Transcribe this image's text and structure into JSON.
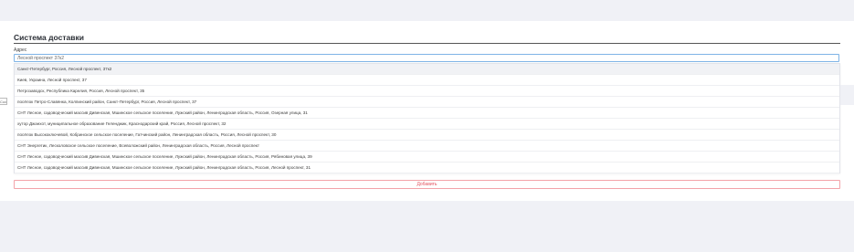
{
  "page": {
    "title": "Система доставки",
    "address_label": "Адрес",
    "left_peek_text": "Сох"
  },
  "search": {
    "value": "Лесной проспект 37к2"
  },
  "suggestions": [
    "Санкт-Петербург, Россия, Лесной проспект, 37к2",
    "Киев, Украина, Лесной проспект, 37",
    "Петрозаводск, Республика Карелия, Россия, Лесной проспект, 35",
    "посёлок Петро-Славянка, Колпинский район, Санкт-Петербург, Россия, Лесной проспект, 37",
    "СНТ Лесное, садоводческий массив Дивенская, Мшинское сельское поселение, Лужский район, Ленинградская область, Россия, Озерная улица, 31",
    "хутор Джанхот, муниципальное образование Геленджик, Краснодарский край, Россия, Лесной проспект, 32",
    "посёлок Высокоключевой, Кобринское сельское поселение, Гатчинский район, Ленинградская область, Россия, Лесной проспект, 30",
    "СНТ Энергетик, Лесколовское сельское поселение, Всеволожский район, Ленинградская область, Россия, Лесной проспект",
    "СНТ Лесное, садоводческий массив Дивенская, Мшинское сельское поселение, Лужский район, Ленинградская область, Россия, Рябиновая улица, 39",
    "СНТ Лесное, садоводческий массив Дивенская, Мшинское сельское поселение, Лужский район, Ленинградская область, Россия, Лесной проспект, 31"
  ],
  "actions": {
    "add_label": "Добавить"
  },
  "colors": {
    "background": "#f0f1f6",
    "input_focus_border": "#7fb4e6",
    "add_button_border": "#f3a3a9",
    "add_button_text": "#e2535f"
  }
}
